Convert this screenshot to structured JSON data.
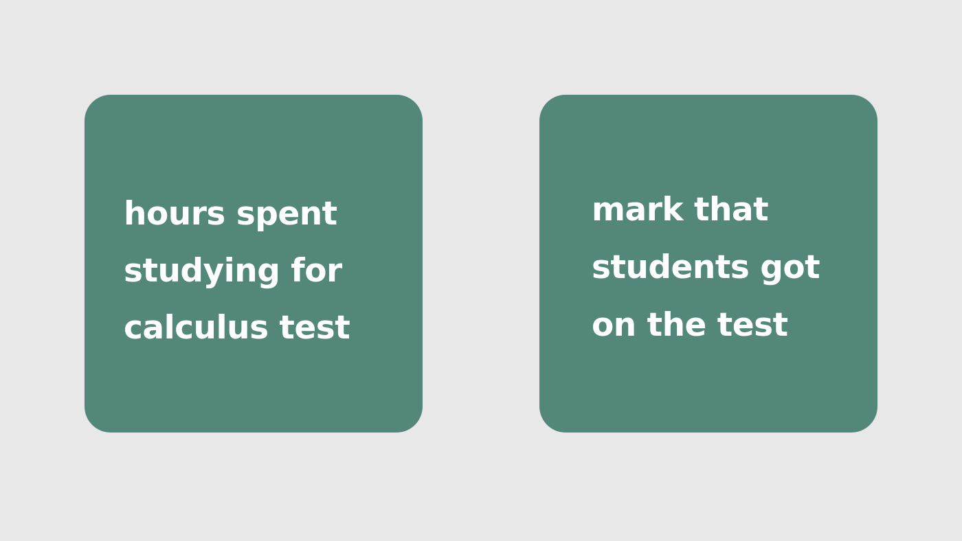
{
  "colors": {
    "background": "#e8e8e8",
    "card": "#53877a",
    "text": "#ffffff"
  },
  "cards": [
    {
      "lines": [
        "hours spent",
        "studying for",
        "calculus test"
      ]
    },
    {
      "lines": [
        "mark that",
        "students got",
        "on the test"
      ]
    }
  ]
}
